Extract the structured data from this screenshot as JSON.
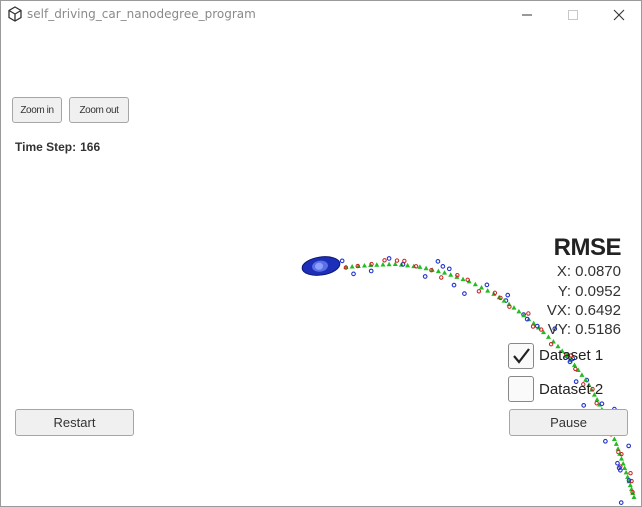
{
  "window": {
    "title": "self_driving_car_nanodegree_program",
    "icons": [
      "unity-logo-icon",
      "minimize-icon",
      "maximize-icon",
      "close-icon"
    ]
  },
  "toolbar": {
    "zoom_in_label": "Zoom in",
    "zoom_out_label": "Zoom out"
  },
  "status": {
    "time_step_label": "Time Step:",
    "time_step_value": "166"
  },
  "rmse": {
    "title": "RMSE",
    "x_label": "X:",
    "x_value": "0.0870",
    "y_label": "Y:",
    "y_value": "0.0952",
    "vx_label": "VX:",
    "vx_value": "0.6492",
    "vy_label": "VY:",
    "vy_value": "0.5186"
  },
  "datasets": [
    {
      "label": "Dataset 1",
      "checked": true
    },
    {
      "label": "Dataset 2",
      "checked": false
    }
  ],
  "controls": {
    "restart_label": "Restart",
    "pause_label": "Pause"
  },
  "colors": {
    "estimate_marker": "#22bb22",
    "lidar_marker": "#cc2222",
    "radar_marker": "#2233cc",
    "car_body": "#2233cc"
  }
}
